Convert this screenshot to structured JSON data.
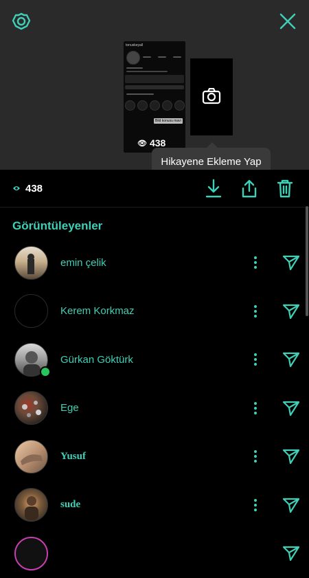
{
  "colors": {
    "accent": "#3fd0b7",
    "online": "#2ac45e"
  },
  "header": {
    "settings_icon": "gear-icon",
    "close_icon": "close-icon"
  },
  "preview": {
    "username": "tonuskeyall",
    "view_count": "438",
    "mini_badge": "Bild konusu mavi",
    "camera_icon": "camera-icon"
  },
  "tooltip": {
    "text": "Hikayene Ekleme Yap"
  },
  "actions": {
    "views_icon": "eye-icon",
    "views_count": "438",
    "download_icon": "download-icon",
    "share_icon": "share-icon",
    "delete_icon": "trash-icon"
  },
  "viewers": {
    "title": "Görüntüleyenler",
    "items": [
      {
        "name": "emin çelik",
        "avatar": "photo",
        "online": false
      },
      {
        "name": "Kerem Korkmaz",
        "avatar": "dark",
        "online": false
      },
      {
        "name": "Gürkan Göktürk",
        "avatar": "photo-gray",
        "online": true
      },
      {
        "name": "Ege",
        "avatar": "photo-crowd",
        "online": false
      },
      {
        "name": "Yusuf",
        "avatar": "photo-hand",
        "online": false
      },
      {
        "name": "sude",
        "avatar": "photo-warm",
        "online": false
      },
      {
        "name": "",
        "avatar": "story-ring",
        "online": false
      }
    ]
  }
}
